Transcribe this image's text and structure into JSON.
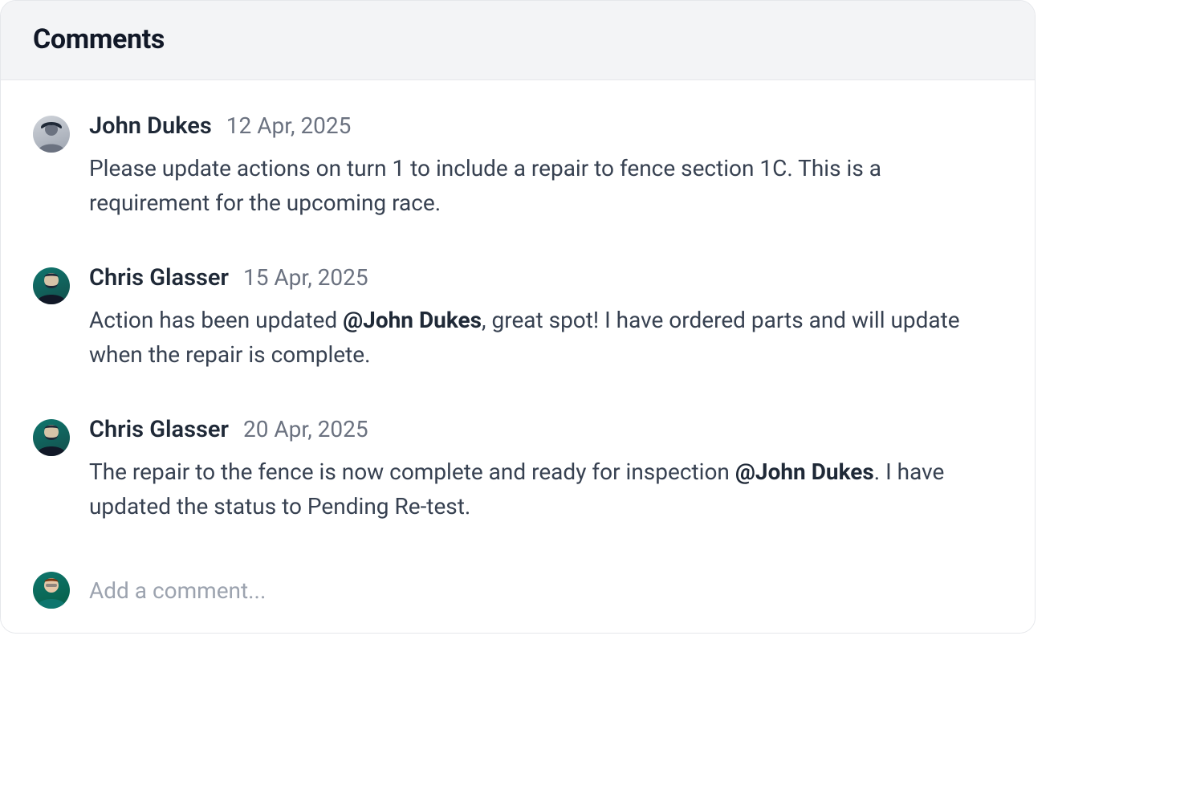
{
  "header": {
    "title": "Comments"
  },
  "comments": [
    {
      "author": "John Dukes",
      "date": "12 Apr, 2025",
      "avatar_kind": "john",
      "body_parts": [
        {
          "type": "text",
          "text": "Please update actions on turn 1 to include a repair to fence section 1C. This is a requirement for the upcoming race."
        }
      ]
    },
    {
      "author": "Chris Glasser",
      "date": "15 Apr, 2025",
      "avatar_kind": "chris",
      "body_parts": [
        {
          "type": "text",
          "text": "Action has been updated "
        },
        {
          "type": "mention",
          "text": "@John Dukes"
        },
        {
          "type": "text",
          "text": ", great spot! I have ordered parts and will update when the repair is complete."
        }
      ]
    },
    {
      "author": "Chris Glasser",
      "date": "20 Apr, 2025",
      "avatar_kind": "chris",
      "body_parts": [
        {
          "type": "text",
          "text": "The repair to the fence is now complete and ready for inspection "
        },
        {
          "type": "mention",
          "text": "@John Dukes"
        },
        {
          "type": "text",
          "text": ". I have updated the status to Pending Re-test."
        }
      ]
    }
  ],
  "composer": {
    "placeholder": "Add a comment...",
    "avatar_kind": "me"
  }
}
